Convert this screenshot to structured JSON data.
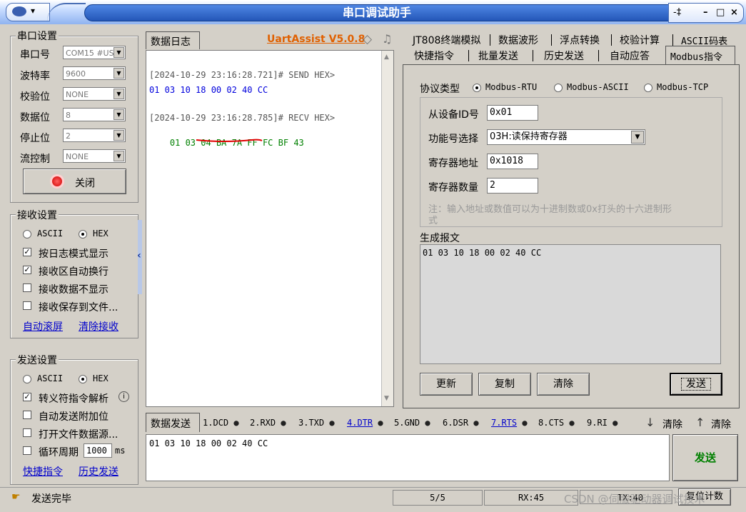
{
  "window": {
    "title": "串口调试助手",
    "sys_menu_glyph": "▾",
    "pin": "-‡",
    "minimize": "–",
    "maximize": "□",
    "close": "×"
  },
  "serial": {
    "legend": "串口设置",
    "port_label": "串口号",
    "port_value": "COM15 #US",
    "baud_label": "波特率",
    "baud_value": "9600",
    "parity_label": "校验位",
    "parity_value": "NONE",
    "databits_label": "数据位",
    "databits_value": "8",
    "stopbits_label": "停止位",
    "stopbits_value": "2",
    "flow_label": "流控制",
    "flow_value": "NONE",
    "close_button": "关闭"
  },
  "receive": {
    "legend": "接收设置",
    "ascii": "ASCII",
    "hex": "HEX",
    "mode_selected": "HEX",
    "opt_log": "按日志模式显示",
    "opt_wrap": "接收区自动换行",
    "opt_hide": "接收数据不显示",
    "opt_save": "接收保存到文件...",
    "link_autoscroll": "自动滚屏",
    "link_clear": "清除接收"
  },
  "send_settings": {
    "legend": "发送设置",
    "ascii": "ASCII",
    "hex": "HEX",
    "opt_escape": "转义符指令解析",
    "opt_append": "自动发送附加位",
    "opt_file": "打开文件数据源...",
    "opt_cycle": "循环周期",
    "cycle_value": "1000",
    "cycle_unit": "ms",
    "link_shortcut": "快捷指令",
    "link_history": "历史发送"
  },
  "log": {
    "tab": "数据日志",
    "brand": "UartAssist V5.0.8",
    "send_header": "[2024-10-29 23:16:28.721]# SEND HEX>",
    "send_data": "01 03 10 18 00 02 40 CC",
    "recv_header": "[2024-10-29 23:16:28.785]# RECV HEX>",
    "recv_prefix": "01 03 04",
    "recv_mid": "BA 7A FF FC",
    "recv_suffix": "BF 43"
  },
  "tabs_top": [
    "JT808终端模拟",
    "数据波形",
    "浮点转换",
    "校验计算",
    "ASCII码表"
  ],
  "tabs_bottom": [
    "快捷指令",
    "批量发送",
    "历史发送",
    "自动应答",
    "Modbus指令"
  ],
  "modbus": {
    "protocol_label": "协议类型",
    "rtu": "Modbus-RTU",
    "ascii": "Modbus-ASCII",
    "tcp": "Modbus-TCP",
    "slave_label": "从设备ID号",
    "slave_value": "0x01",
    "func_label": "功能号选择",
    "func_value": "03H:读保持寄存器",
    "addr_label": "寄存器地址",
    "addr_value": "0x1018",
    "count_label": "寄存器数量",
    "count_value": "2",
    "note_line1": "注：输入地址或数值可以为十进制数或0x打头的十六进制形",
    "note_line2": "式",
    "gen_label": "生成报文",
    "gen_value": "01 03 10 18 00 02 40 CC",
    "btn_update": "更新",
    "btn_copy": "复制",
    "btn_clear": "清除",
    "btn_send": "发送"
  },
  "send_bar": {
    "tab": "数据发送",
    "pins": [
      {
        "label": "1.DCD",
        "link": false
      },
      {
        "label": "2.RXD",
        "link": false
      },
      {
        "label": "3.TXD",
        "link": false
      },
      {
        "label": "4.DTR",
        "link": true
      },
      {
        "label": "5.GND",
        "link": false
      },
      {
        "label": "6.DSR",
        "link": false
      },
      {
        "label": "7.RTS",
        "link": true
      },
      {
        "label": "8.CTS",
        "link": false
      },
      {
        "label": "9.RI",
        "link": false
      }
    ],
    "clear1": "清除",
    "clear2": "清除",
    "input_value": "01 03 10 18 00 02 40 CC",
    "send_button": "发送"
  },
  "status": {
    "message": "发送完毕",
    "count": "5/5",
    "rx": "RX:45",
    "tx": "TX:40",
    "reset": "复位计数",
    "watermark": "CSDN @伺服驱动器调试技术"
  }
}
